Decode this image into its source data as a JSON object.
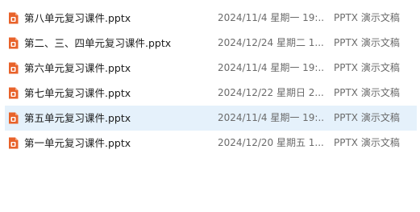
{
  "colors": {
    "selected_row_bg": "#e5f1fb",
    "pptx_icon": "#e8622a",
    "secondary_text": "#6b6b6b"
  },
  "files": [
    {
      "name": "第八单元复习课件.pptx",
      "modified": "2024/11/4 星期一 19:...",
      "type": "PPTX 演示文稿",
      "icon": "powerpoint-file-icon",
      "selected": false
    },
    {
      "name": "第二、三、四单元复习课件.pptx",
      "modified": "2024/12/24 星期二 1...",
      "type": "PPTX 演示文稿",
      "icon": "powerpoint-file-icon",
      "selected": false
    },
    {
      "name": "第六单元复习课件.pptx",
      "modified": "2024/11/4 星期一 19:...",
      "type": "PPTX 演示文稿",
      "icon": "powerpoint-file-icon",
      "selected": false
    },
    {
      "name": "第七单元复习课件.pptx",
      "modified": "2024/12/22 星期日 2...",
      "type": "PPTX 演示文稿",
      "icon": "powerpoint-file-icon",
      "selected": false
    },
    {
      "name": "第五单元复习课件.pptx",
      "modified": "2024/11/4 星期一 19:...",
      "type": "PPTX 演示文稿",
      "icon": "powerpoint-file-icon",
      "selected": true
    },
    {
      "name": "第一单元复习课件.pptx",
      "modified": "2024/12/20 星期五 1...",
      "type": "PPTX 演示文稿",
      "icon": "powerpoint-file-icon",
      "selected": false
    }
  ]
}
